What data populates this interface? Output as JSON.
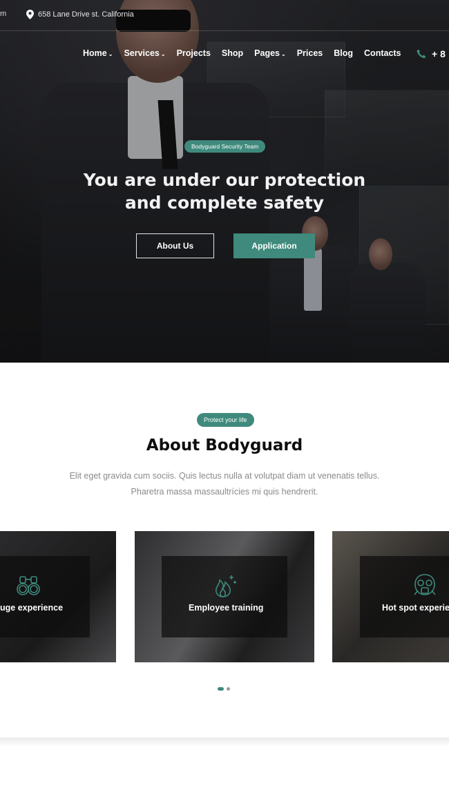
{
  "topbar": {
    "email_fragment": "m",
    "address": "658 Lane Drive st. California"
  },
  "nav": {
    "items": [
      {
        "label": "Home",
        "dropdown": true
      },
      {
        "label": "Services",
        "dropdown": true
      },
      {
        "label": "Projects",
        "dropdown": false
      },
      {
        "label": "Shop",
        "dropdown": false
      },
      {
        "label": "Pages",
        "dropdown": true
      },
      {
        "label": "Prices",
        "dropdown": false
      },
      {
        "label": "Blog",
        "dropdown": false
      },
      {
        "label": "Contacts",
        "dropdown": false
      }
    ],
    "phone": "+ 8"
  },
  "hero": {
    "badge": "Bodyguard Security Team",
    "title_line1": "You are under our protection",
    "title_line2": "and complete safety",
    "btn_about": "About Us",
    "btn_application": "Application"
  },
  "about": {
    "badge": "Protect your life",
    "title": "About Bodyguard",
    "text_line1": "Elit eget gravida cum sociis. Quis lectus nulla at volutpat diam ut venenatis tellus.",
    "text_line2": "Pharetra massa massaultrícies mi quis hendrerit."
  },
  "cards": [
    {
      "label": "uge experience",
      "icon": "handcuffs-icon"
    },
    {
      "label": "Employee training",
      "icon": "fire-icon"
    },
    {
      "label": "Hot spot experie",
      "icon": "gas-mask-icon"
    }
  ],
  "slider": {
    "total": 2,
    "active": 1
  },
  "colors": {
    "accent": "#3f8a7c",
    "dark": "#1b1b1d"
  }
}
